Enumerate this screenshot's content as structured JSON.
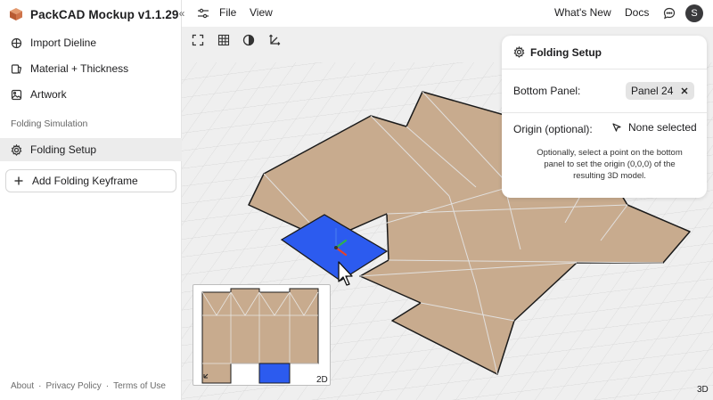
{
  "app": {
    "name": "PackCAD Mockup",
    "version": "v1.1.29"
  },
  "sidebar": {
    "items": [
      {
        "label": "Import Dieline",
        "icon": "import-dieline-icon"
      },
      {
        "label": "Material + Thickness",
        "icon": "material-icon"
      },
      {
        "label": "Artwork",
        "icon": "image-icon"
      }
    ],
    "section_label": "Folding Simulation",
    "active_item": {
      "label": "Folding Setup",
      "icon": "gear-icon"
    },
    "add_keyframe": {
      "label": "Add Folding Keyframe",
      "icon": "plus-icon"
    },
    "footer": [
      "About",
      "·",
      "Privacy Policy",
      "·",
      "Terms of Use"
    ]
  },
  "topbar": {
    "collapse_glyph": "«",
    "menus": [
      "File",
      "View"
    ],
    "whats_new": "What's New",
    "docs": "Docs",
    "avatar_initial": "S"
  },
  "toolbar": [
    "fullscreen-icon",
    "grid-icon",
    "contrast-icon",
    "axes-icon"
  ],
  "panel": {
    "title": "Folding Setup",
    "bottom_panel_label": "Bottom Panel:",
    "bottom_panel_value": "Panel 24",
    "origin_label": "Origin (optional):",
    "origin_value": "None selected",
    "help_text": "Optionally, select a point on the bottom panel to set the origin (0,0,0) of the resulting 3D model."
  },
  "minimap": {
    "label": "2D"
  },
  "view_mode": "3D",
  "colors": {
    "accent_blue": "#2c5bef",
    "cardboard": "#c8ab8e",
    "grid_bg": "#efefef"
  }
}
